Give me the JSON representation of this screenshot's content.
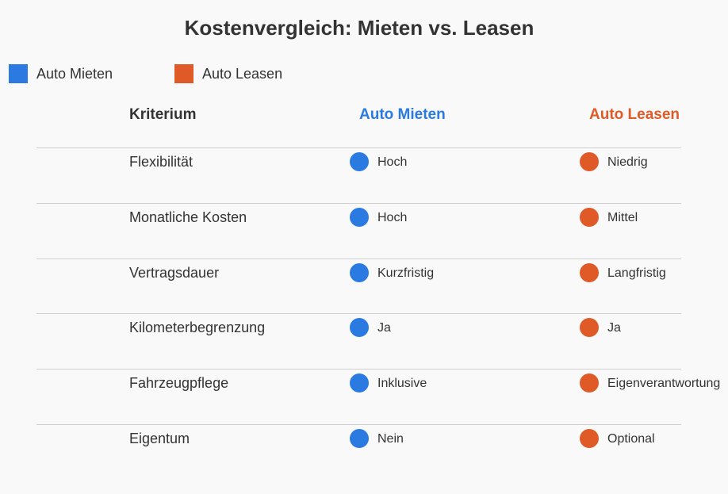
{
  "chart_data": {
    "type": "table",
    "title": "Kostenvergleich: Mieten vs. Leasen",
    "legend": [
      {
        "name": "Auto Mieten",
        "color": "#2a7ae2"
      },
      {
        "name": "Auto Leasen",
        "color": "#e05a28"
      }
    ],
    "legend_placement": "top-left",
    "columns": [
      "Kriterium",
      "Auto Mieten",
      "Auto Leasen"
    ],
    "rows": [
      {
        "criterion": "Flexibilität",
        "mieten": "Hoch",
        "leasen": "Niedrig"
      },
      {
        "criterion": "Monatliche Kosten",
        "mieten": "Hoch",
        "leasen": "Mittel"
      },
      {
        "criterion": "Vertragsdauer",
        "mieten": "Kurzfristig",
        "leasen": "Langfristig"
      },
      {
        "criterion": "Kilometerbegrenzung",
        "mieten": "Ja",
        "leasen": "Ja"
      },
      {
        "criterion": "Fahrzeugpflege",
        "mieten": "Inklusive",
        "leasen": "Eigenverantwortung"
      },
      {
        "criterion": "Eigentum",
        "mieten": "Nein",
        "leasen": "Optional"
      }
    ]
  },
  "colors": {
    "mieten": "#2a7ae2",
    "leasen": "#e05a28",
    "text": "#333333",
    "background": "#f9f9f9"
  }
}
